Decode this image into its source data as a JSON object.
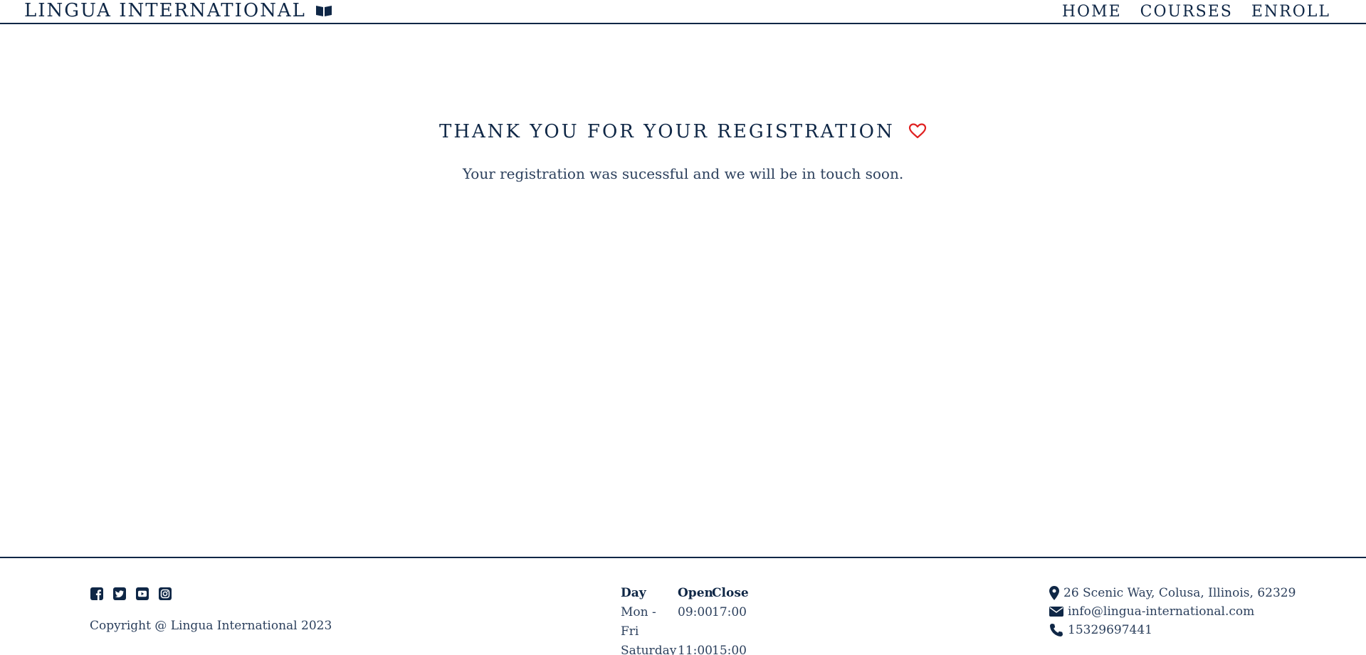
{
  "header": {
    "brand_name": "LINGUA INTERNATIONAL",
    "brand_icon": "open-book-icon",
    "nav": [
      {
        "label": "HOME"
      },
      {
        "label": "COURSES"
      },
      {
        "label": "ENROLL"
      }
    ]
  },
  "main": {
    "title": "THANK YOU FOR YOUR REGISTRATION",
    "title_icon": "heart-outline-icon",
    "message": "Your registration was sucessful and we will be in touch soon."
  },
  "footer": {
    "social_icons": [
      "facebook-icon",
      "twitter-icon",
      "youtube-icon",
      "instagram-icon"
    ],
    "copyright": "Copyright @ Lingua International 2023",
    "hours": {
      "headers": {
        "day": "Day",
        "open": "Open",
        "close": "Close"
      },
      "rows": [
        {
          "day": "Mon - Fri",
          "open": "09:00",
          "close": "17:00"
        },
        {
          "day": "Saturday",
          "open": "11:00",
          "close": "15:00"
        }
      ]
    },
    "contact": {
      "address": "26 Scenic Way, Colusa, Illinois, 62329",
      "email": "info@lingua-international.com",
      "phone": "15329697441"
    }
  },
  "colors": {
    "primary": "#0f2746",
    "text": "#2b3f5c",
    "heart": "#e02020"
  }
}
